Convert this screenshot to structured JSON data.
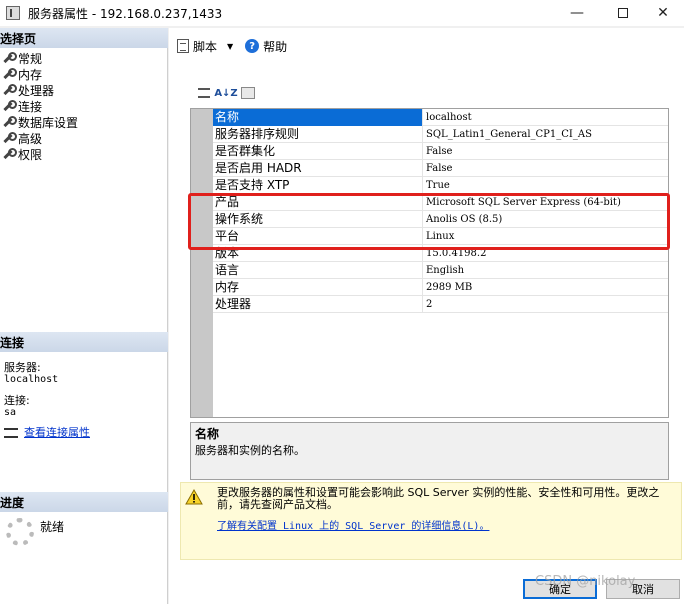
{
  "window": {
    "title": "服务器属性 - 192.168.0.237,1433",
    "minimize_glyph": "—",
    "close_glyph": "✕"
  },
  "sidebar": {
    "select_page_header": "选择页",
    "items": [
      {
        "label": "常规"
      },
      {
        "label": "内存"
      },
      {
        "label": "处理器"
      },
      {
        "label": "连接"
      },
      {
        "label": "数据库设置"
      },
      {
        "label": "高级"
      },
      {
        "label": "权限"
      }
    ],
    "connection_header": "连接",
    "server_label": "服务器:",
    "server_value": "localhost",
    "connection_label": "连接:",
    "connection_value": "sa",
    "view_connection_props": "查看连接属性",
    "progress_header": "进度",
    "progress_status": "就绪"
  },
  "toolbar": {
    "script_label": "脚本",
    "dropdown_glyph": "▼",
    "help_label": "帮助",
    "help_glyph": "?"
  },
  "grid_tools": {
    "az_label": "A↓Z"
  },
  "properties": [
    {
      "name": "名称",
      "value": "localhost"
    },
    {
      "name": "服务器排序规则",
      "value": "SQL_Latin1_General_CP1_CI_AS"
    },
    {
      "name": "是否群集化",
      "value": "False"
    },
    {
      "name": "是否启用 HADR",
      "value": "False"
    },
    {
      "name": "是否支持 XTP",
      "value": "True"
    },
    {
      "name": "产品",
      "value": "Microsoft SQL Server Express (64-bit)"
    },
    {
      "name": "操作系统",
      "value": "Anolis OS (8.5)"
    },
    {
      "name": "平台",
      "value": "Linux"
    },
    {
      "name": "版本",
      "value": "15.0.4198.2"
    },
    {
      "name": "语言",
      "value": "English"
    },
    {
      "name": "内存",
      "value": "2989 MB"
    },
    {
      "name": "处理器",
      "value": "2"
    }
  ],
  "description": {
    "title": "名称",
    "text": "服务器和实例的名称。"
  },
  "warning": {
    "text": "更改服务器的属性和设置可能会影响此 SQL Server 实例的性能、安全性和可用性。更改之前，请先查阅产品文档。",
    "link": "了解有关配置 Linux 上的 SQL Server 的详细信息(L)。"
  },
  "buttons": {
    "ok": "确定",
    "cancel": "取消"
  },
  "watermark": "CSDN @nikolay",
  "colors": {
    "selection": "#0a6cd6",
    "highlight_box": "#e0201c",
    "warning_bg": "#fffbd8",
    "link": "#0033cc"
  }
}
